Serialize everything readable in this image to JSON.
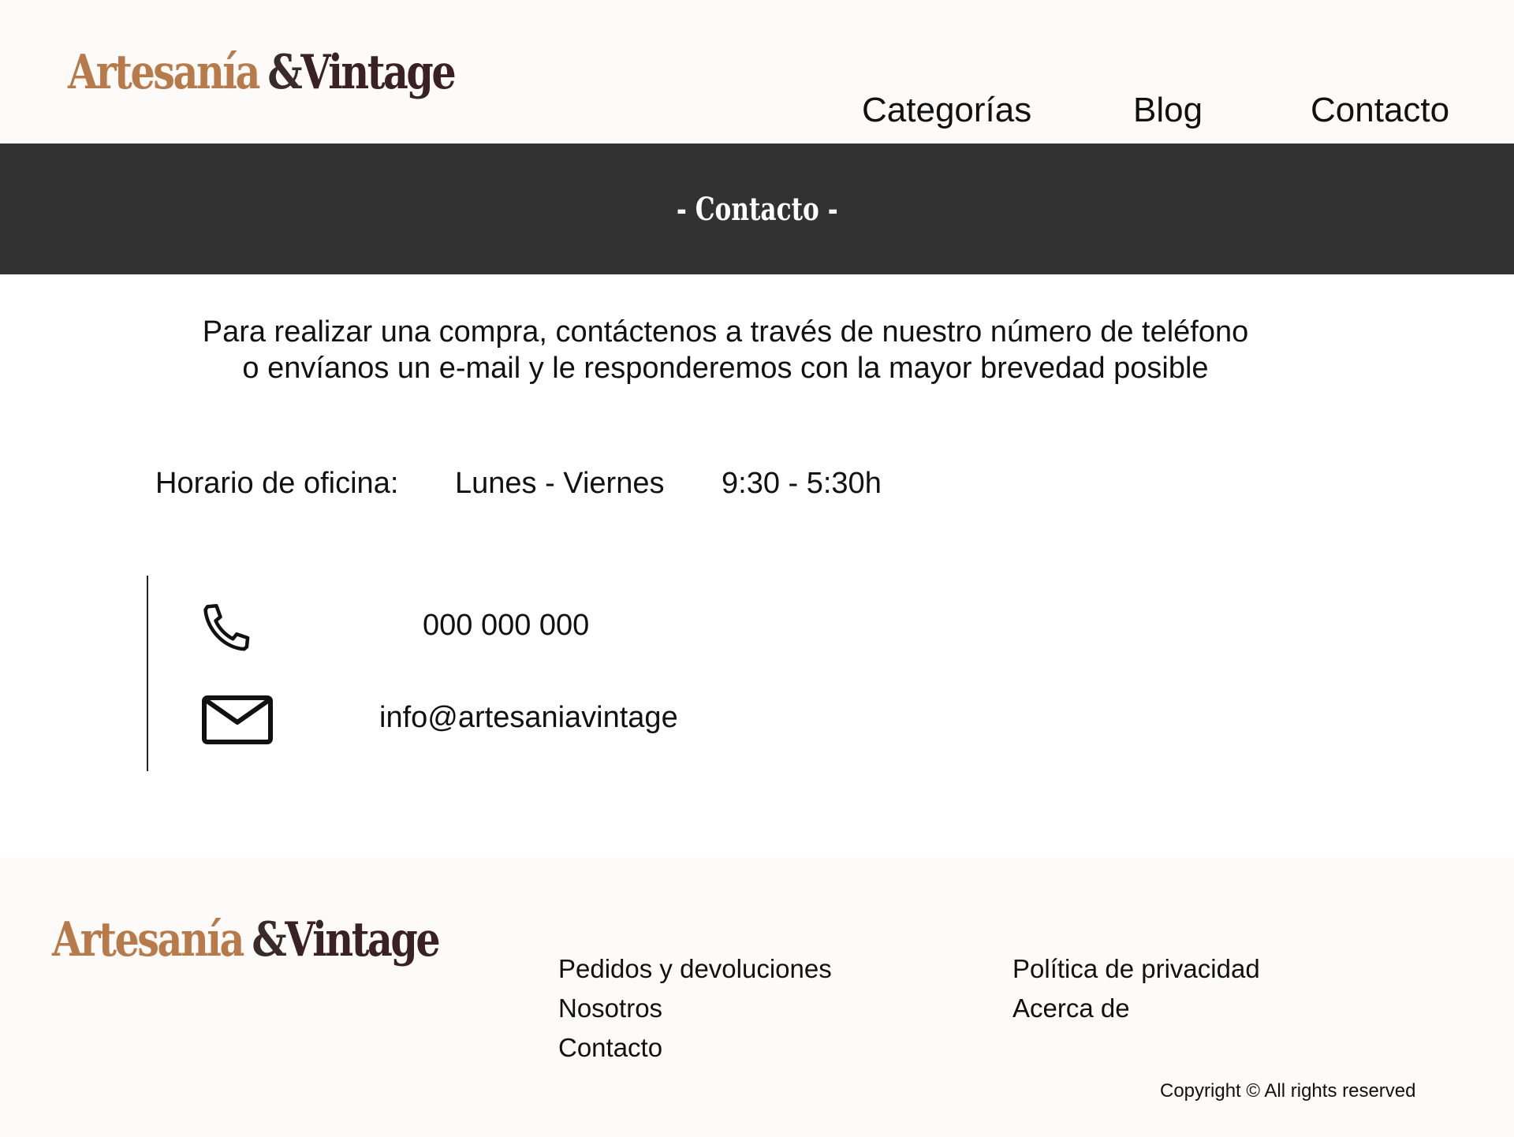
{
  "header": {
    "logo": {
      "word1": "Artesanía",
      "amp": "&",
      "word2": "Vintage"
    },
    "nav": [
      {
        "label": "Categorías"
      },
      {
        "label": "Blog"
      },
      {
        "label": "Contacto"
      }
    ]
  },
  "banner": {
    "title": "- Contacto -"
  },
  "main": {
    "intro_line1": "Para realizar una compra, contáctenos a través de nuestro número de teléfono",
    "intro_line2": "o envíanos un e-mail y le responderemos con la mayor brevedad posible",
    "hours": {
      "label": "Horario de oficina:",
      "days": "Lunes - Viernes",
      "time": "9:30 - 5:30h"
    },
    "contact": {
      "phone": "000 000 000",
      "email": "info@artesaniavintage",
      "phone_icon": "phone-icon",
      "mail_icon": "mail-icon"
    }
  },
  "footer": {
    "logo": {
      "word1": "Artesanía",
      "amp": "&",
      "word2": "Vintage"
    },
    "links_col1": [
      "Pedidos y devoluciones",
      "Nosotros",
      "Contacto"
    ],
    "links_col2": [
      "Política de privacidad",
      "Acerca de"
    ],
    "copyright": "Copyright © All rights reserved"
  },
  "colors": {
    "logo_accent": "#b77a48",
    "logo_dark": "#3a2125",
    "banner_bg": "#323232",
    "header_bg": "#fcfbfa"
  }
}
